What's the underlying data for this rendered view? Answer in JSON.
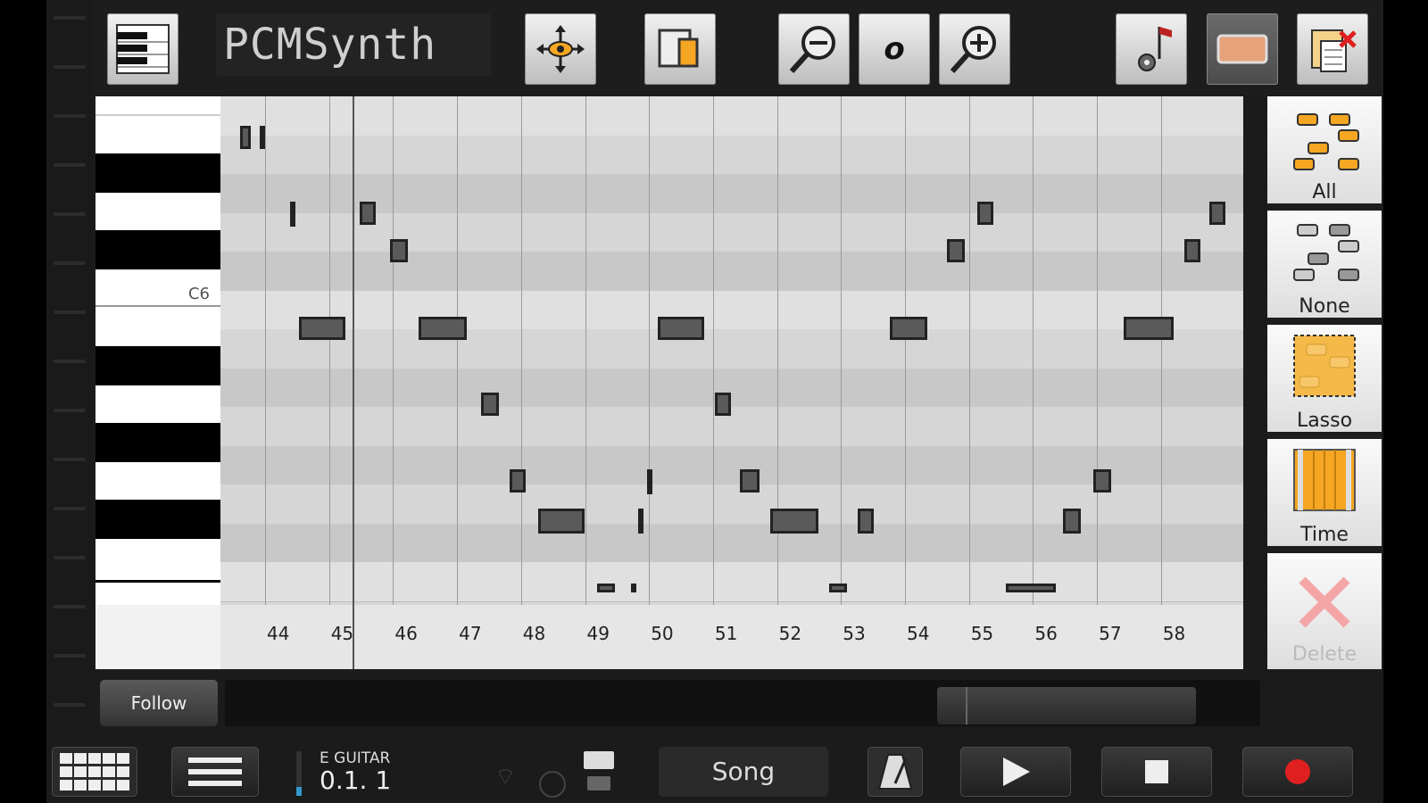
{
  "header": {
    "instrument_name": "PCMSynth",
    "zoom_value": "o"
  },
  "piano_roll": {
    "octave_label": "C6",
    "bars": [
      "44",
      "45",
      "46",
      "47",
      "48",
      "49",
      "50",
      "51",
      "52",
      "53",
      "54",
      "55",
      "56",
      "57",
      "58"
    ]
  },
  "selection_tools": {
    "all_label": "All",
    "none_label": "None",
    "lasso_label": "Lasso",
    "time_label": "Time",
    "delete_label": "Delete"
  },
  "footer": {
    "follow_label": "Follow",
    "track_name": "E GUITAR",
    "position": "0.1. 1",
    "song_label": "Song"
  },
  "colors": {
    "accent_orange": "#f5a623",
    "record_red": "#e02020",
    "delete_pink": "#f4a6a6"
  },
  "icons": {
    "keyboard": "keyboard-icon",
    "move": "move-arrows-icon",
    "copy": "copy-icon",
    "zoom_out": "zoom-out-icon",
    "zoom_in": "zoom-in-icon",
    "note_settings": "note-settings-icon",
    "rect": "rectangle-icon",
    "paste_delete": "clipboard-delete-icon"
  }
}
